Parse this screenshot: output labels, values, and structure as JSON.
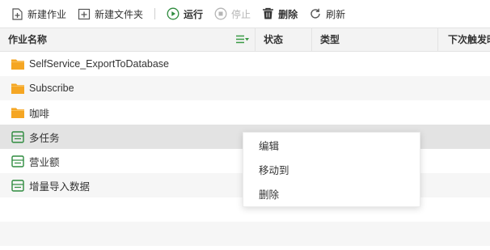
{
  "toolbar": {
    "new_job": "新建作业",
    "new_folder": "新建文件夹",
    "run": "运行",
    "stop": "停止",
    "delete": "删除",
    "refresh": "刷新"
  },
  "table": {
    "columns": [
      "作业名称",
      "状态",
      "类型",
      "下次触发时"
    ],
    "rows": [
      {
        "name": "SelfService_ExportToDatabase",
        "icon": "folder-icon"
      },
      {
        "name": "Subscribe",
        "icon": "folder-icon"
      },
      {
        "name": "咖啡",
        "icon": "folder-icon"
      },
      {
        "name": "多任务",
        "icon": "job-icon"
      },
      {
        "name": "营业额",
        "icon": "job-icon"
      },
      {
        "name": "增量导入数据",
        "icon": "job-icon"
      }
    ]
  },
  "context_menu": {
    "items": [
      "编辑",
      "移动到",
      "删除"
    ]
  },
  "colors": {
    "folder": "#f5a623",
    "job": "#2e8b3e",
    "run_icon": "#2e8b3e",
    "filter_icon": "#3a9a44",
    "selected_row": "#e3e3e3"
  }
}
